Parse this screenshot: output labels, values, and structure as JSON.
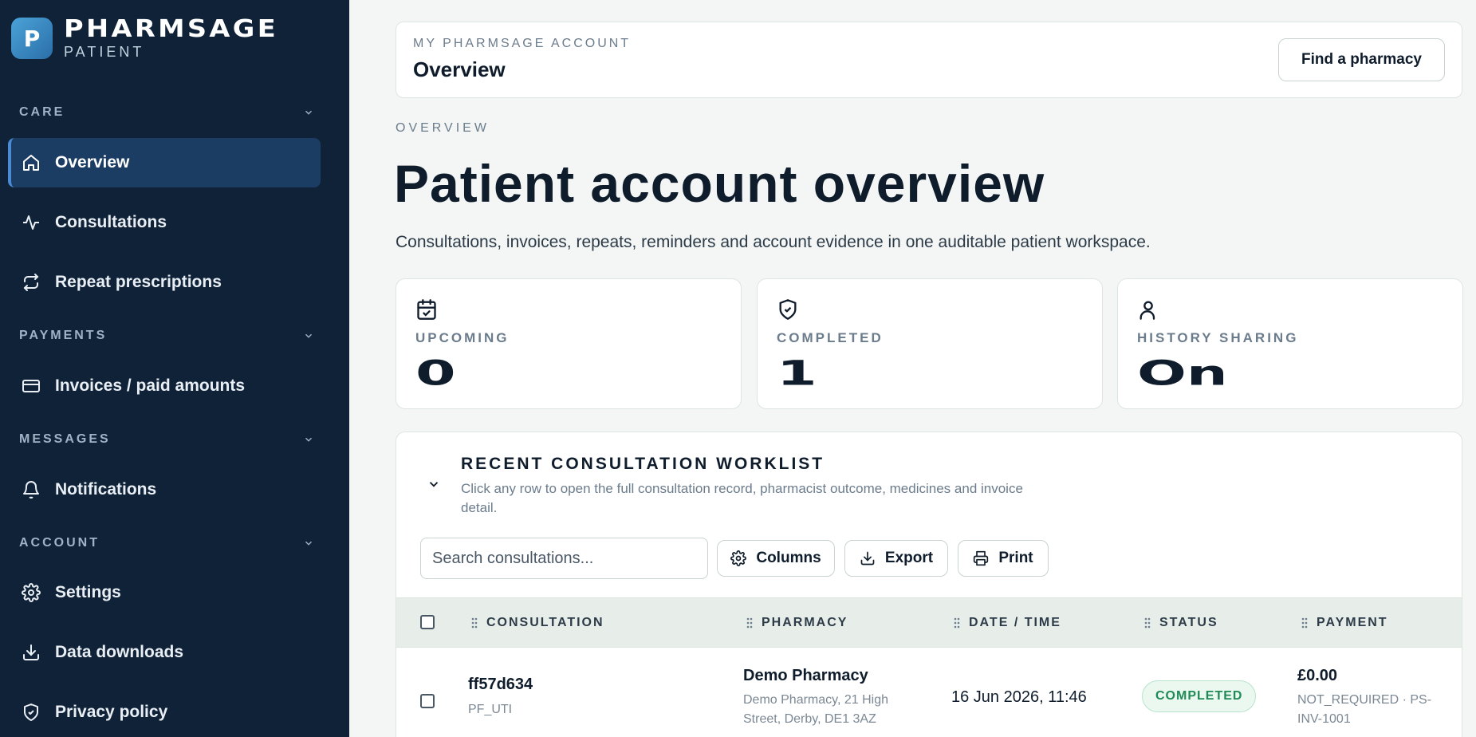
{
  "brand": {
    "logo_letter": "P",
    "name": "PHARMSAGE",
    "sub": "PATIENT"
  },
  "sidebar": {
    "sections": [
      {
        "label": "CARE"
      },
      {
        "label": "PAYMENTS"
      },
      {
        "label": "MESSAGES"
      },
      {
        "label": "ACCOUNT"
      }
    ],
    "items": [
      {
        "label": "Overview",
        "icon": "home-icon",
        "active": true
      },
      {
        "label": "Consultations",
        "icon": "activity-icon"
      },
      {
        "label": "Repeat prescriptions",
        "icon": "repeat-icon"
      },
      {
        "label": "Invoices / paid amounts",
        "icon": "credit-card-icon"
      },
      {
        "label": "Notifications",
        "icon": "bell-icon"
      },
      {
        "label": "Settings",
        "icon": "gear-icon"
      },
      {
        "label": "Data downloads",
        "icon": "download-icon"
      },
      {
        "label": "Privacy policy",
        "icon": "shield-icon"
      }
    ]
  },
  "header": {
    "eyebrow": "MY PHARMSAGE ACCOUNT",
    "title": "Overview",
    "find_button": "Find a pharmacy"
  },
  "main": {
    "eyebrow": "OVERVIEW",
    "title": "Patient account overview",
    "description": "Consultations, invoices, repeats, reminders and account evidence in one auditable patient workspace."
  },
  "stats": [
    {
      "label": "UPCOMING",
      "value": "0",
      "icon": "calendar-check-icon"
    },
    {
      "label": "COMPLETED",
      "value": "1",
      "icon": "shield-check-icon"
    },
    {
      "label": "HISTORY SHARING",
      "value": "On",
      "icon": "user-icon"
    }
  ],
  "worklist": {
    "title": "RECENT CONSULTATION WORKLIST",
    "description": "Click any row to open the full consultation record, pharmacist outcome, medicines and invoice detail.",
    "search_placeholder": "Search consultations...",
    "buttons": {
      "columns": "Columns",
      "export": "Export",
      "print": "Print"
    },
    "columns": [
      "CONSULTATION",
      "PHARMACY",
      "DATE / TIME",
      "STATUS",
      "PAYMENT"
    ],
    "rows": [
      {
        "id": "ff57d634",
        "type": "PF_UTI",
        "pharmacy": "Demo Pharmacy",
        "address_line1": "Demo Pharmacy, 21 High",
        "address_line2": "Street, Derby, DE1 3AZ",
        "datetime": "16 Jun 2026, 11:46",
        "status": "COMPLETED",
        "amount": "£0.00",
        "payment_line1": "NOT_REQUIRED · PS-",
        "payment_line2": "INV-1001"
      }
    ]
  },
  "colors": {
    "sidebar_bg": "#0f2237",
    "active_bg": "#1b3c63",
    "badge_green": "#1f8a55",
    "page_bg": "#f3f6f4"
  }
}
